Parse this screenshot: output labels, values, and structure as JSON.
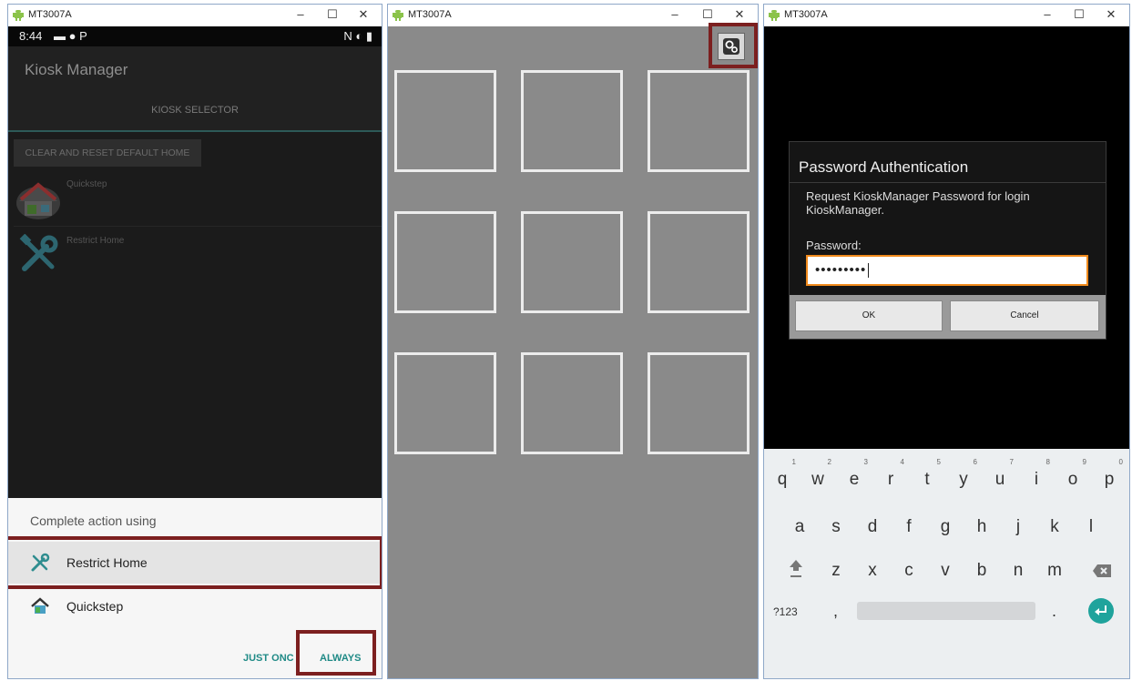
{
  "windows": [
    {
      "title": "MT3007A",
      "controls": {
        "minimize": "–",
        "maximize": "☐",
        "close": "✕"
      }
    },
    {
      "title": "MT3007A",
      "controls": {
        "minimize": "–",
        "maximize": "☐",
        "close": "✕"
      }
    },
    {
      "title": "MT3007A",
      "controls": {
        "minimize": "–",
        "maximize": "☐",
        "close": "✕"
      }
    }
  ],
  "kiosk": {
    "status_time": "8:44",
    "status_left_icons": "▬ ● P",
    "status_right_icons": "N ◐ ▮",
    "app_title": "Kiosk Manager",
    "tab_label": "KIOSK SELECTOR",
    "clear_button": "CLEAR AND RESET DEFAULT HOME",
    "list_items": [
      {
        "label": "Quickstep",
        "icon": "house-icon"
      },
      {
        "label": "Restrict Home",
        "icon": "tools-icon"
      }
    ],
    "sheet": {
      "title": "Complete action using",
      "options": [
        {
          "label": "Restrict Home",
          "icon": "tools-icon",
          "selected": true
        },
        {
          "label": "Quickstep",
          "icon": "house-icon",
          "selected": false
        }
      ],
      "just_once": "JUST ONC",
      "always": "ALWAYS"
    }
  },
  "grid": {
    "tile_count": 9,
    "settings_icon": "gear-icon"
  },
  "auth": {
    "dialog_title": "Password Authentication",
    "message": "Request KioskManager Password for login KioskManager.",
    "password_label": "Password:",
    "password_value": "•••••••••",
    "ok_label": "OK",
    "cancel_label": "Cancel",
    "keyboard": {
      "row1": [
        {
          "key": "q",
          "hint": "1"
        },
        {
          "key": "w",
          "hint": "2"
        },
        {
          "key": "e",
          "hint": "3"
        },
        {
          "key": "r",
          "hint": "4"
        },
        {
          "key": "t",
          "hint": "5"
        },
        {
          "key": "y",
          "hint": "6"
        },
        {
          "key": "u",
          "hint": "7"
        },
        {
          "key": "i",
          "hint": "8"
        },
        {
          "key": "o",
          "hint": "9"
        },
        {
          "key": "p",
          "hint": "0"
        }
      ],
      "row2": [
        "a",
        "s",
        "d",
        "f",
        "g",
        "h",
        "j",
        "k",
        "l"
      ],
      "row3": [
        "z",
        "x",
        "c",
        "v",
        "b",
        "n",
        "m"
      ],
      "symbols_key": "?123",
      "comma_key": ",",
      "period_key": "."
    }
  },
  "colors": {
    "highlight": "#7c1f1f",
    "accent_teal": "#1f8a86",
    "input_border": "#f08a1c",
    "tile_border": "#ececec"
  }
}
